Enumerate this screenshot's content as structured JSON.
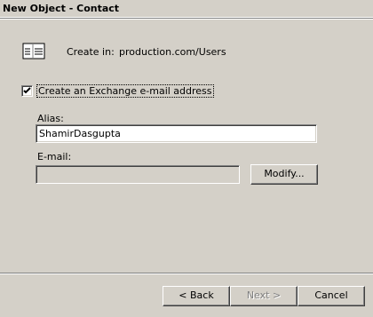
{
  "window": {
    "title": "New Object - Contact"
  },
  "header": {
    "icon": "contact-card-icon",
    "create_in_label": "Create in:",
    "create_in_value": "production.com/Users"
  },
  "exchange": {
    "checkbox_label": "Create an Exchange e-mail address",
    "checked": true
  },
  "alias": {
    "label": "Alias:",
    "value": "ShamirDasgupta"
  },
  "email": {
    "label": "E-mail:",
    "value": "",
    "modify_label": "Modify..."
  },
  "footer": {
    "back_label": "< Back",
    "next_label": "Next >",
    "cancel_label": "Cancel"
  }
}
